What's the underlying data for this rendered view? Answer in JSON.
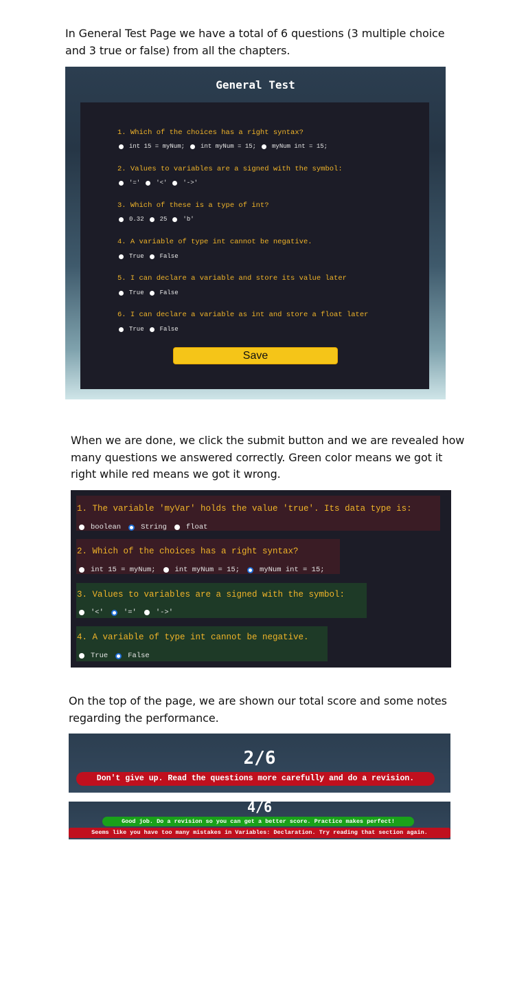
{
  "texts": {
    "p1_line1": "In General Test Page we have a total of 6 questions (3 multiple choice",
    "p1_line2": "and 3 true or false) from all the chapters.",
    "p2_line1": "When we are done, we click the submit button and we are revealed how",
    "p2_line2": "many questions we answered correctly. Green color means we got it",
    "p2_line3": "right while red means we got it wrong.",
    "p3_line1": "On the top of the page, we are shown our total score and some notes",
    "p3_line2": "regarding the performance."
  },
  "general_test": {
    "title": "General Test",
    "questions": [
      {
        "q": "1. Which of the choices has a right syntax?",
        "options": [
          "int 15 = myNum;",
          "int myNum = 15;",
          "myNum int = 15;"
        ]
      },
      {
        "q": "2. Values to variables are a signed with the symbol:",
        "options": [
          "'='",
          "'<'",
          "'->'"
        ]
      },
      {
        "q": "3. Which of these is a type of int?",
        "options": [
          "0.32",
          "25",
          "'b'"
        ]
      },
      {
        "q": "4. A variable of type int cannot be negative.",
        "options": [
          "True",
          "False"
        ]
      },
      {
        "q": "5. I can declare a variable and store its value later",
        "options": [
          "True",
          "False"
        ]
      },
      {
        "q": "6. I can declare a variable as int and store a float later",
        "options": [
          "True",
          "False"
        ]
      }
    ],
    "save_label": "Save"
  },
  "results": {
    "red_color": "#3a1c25",
    "green_color": "#1e3a27",
    "questions": [
      {
        "q": "1. The variable 'myVar' holds the value 'true'. Its data type is:",
        "options": [
          "boolean",
          "String",
          "float"
        ],
        "selected": 1,
        "status": "wrong"
      },
      {
        "q": "2. Which of the choices has a right syntax?",
        "options": [
          "int 15 = myNum;",
          "int myNum = 15;",
          "myNum int = 15;"
        ],
        "selected": 2,
        "status": "wrong"
      },
      {
        "q": "3. Values to variables are a signed with the symbol:",
        "options": [
          "'<'",
          "'='",
          "'->'"
        ],
        "selected": 1,
        "status": "right"
      },
      {
        "q": "4. A variable of type int cannot be negative.",
        "options": [
          "True",
          "False"
        ],
        "selected": 1,
        "status": "right"
      }
    ]
  },
  "score1": {
    "score": "2/6",
    "message": "Don't give up. Read the questions more carefully and do a revision."
  },
  "score2": {
    "score": "4/6",
    "message_good": "Good job. Do a revision so you can get a better score. Practice makes perfect!",
    "message_bad": "Seems like you have too many mistakes in Variables: Declaration. Try reading that section again."
  }
}
